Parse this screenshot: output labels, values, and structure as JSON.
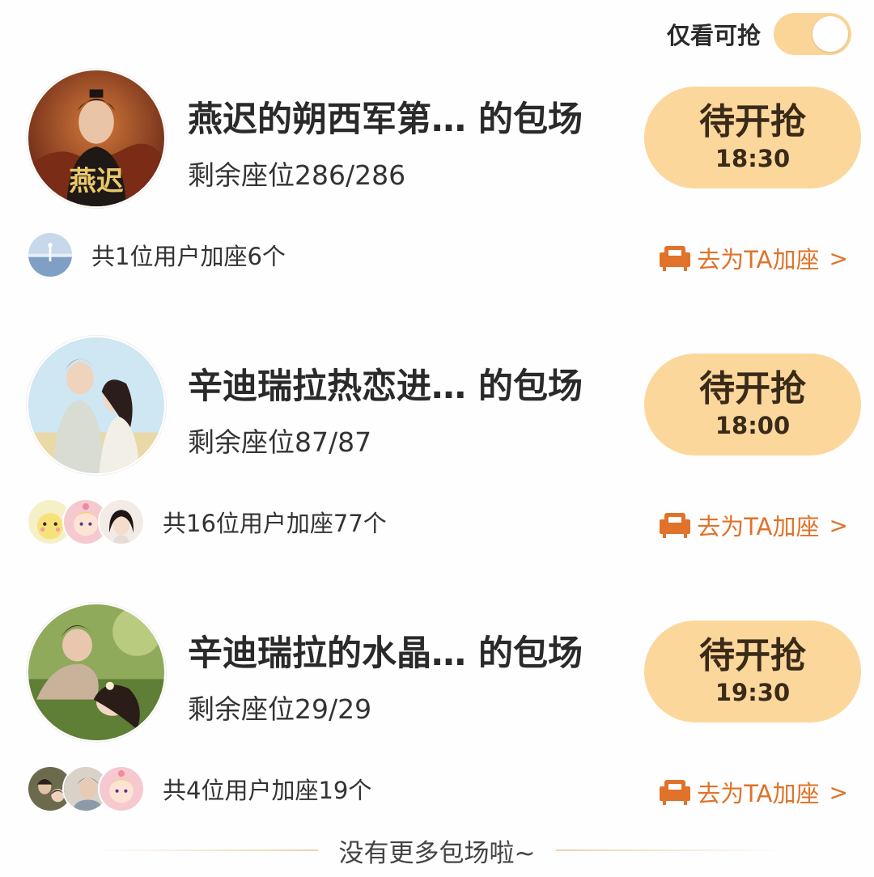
{
  "filter": {
    "label": "仅看可抢",
    "enabled": true
  },
  "colors": {
    "accent_button": "#fcd79c",
    "toggle": "#fad597",
    "link": "#e0722a"
  },
  "items": [
    {
      "title": "燕迟的朔西军第… 的包场",
      "poster_text": "燕迟",
      "seats": "剩余座位286/286",
      "button_label": "待开抢",
      "button_time": "18:30",
      "users_text": "共1位用户加座6个",
      "add_seat": "去为TA加座",
      "add_seat_icon": "sofa-icon",
      "chevron": ">"
    },
    {
      "title": "辛迪瑞拉热恋进… 的包场",
      "seats": "剩余座位87/87",
      "button_label": "待开抢",
      "button_time": "18:00",
      "users_text": "共16位用户加座77个",
      "add_seat": "去为TA加座",
      "add_seat_icon": "sofa-icon",
      "chevron": ">"
    },
    {
      "title": "辛迪瑞拉的水晶… 的包场",
      "seats": "剩余座位29/29",
      "button_label": "待开抢",
      "button_time": "19:30",
      "users_text": "共4位用户加座19个",
      "add_seat": "去为TA加座",
      "add_seat_icon": "sofa-icon",
      "chevron": ">"
    }
  ],
  "footer": {
    "text": "没有更多包场啦~"
  }
}
